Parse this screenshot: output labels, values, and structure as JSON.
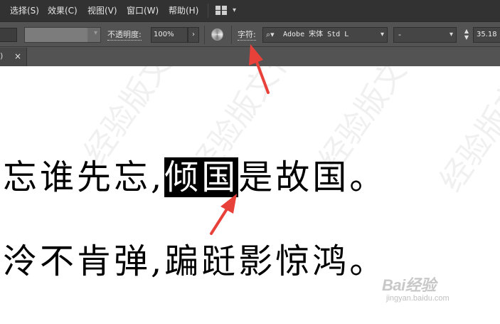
{
  "menubar": {
    "items": [
      "选择(S)",
      "效果(C)",
      "视图(V)",
      "窗口(W)",
      "帮助(H)"
    ]
  },
  "control_bar": {
    "opacity_label": "不透明度:",
    "opacity_value": "100%",
    "character_label": "字符:",
    "font_family": "Adobe 宋体 Std L",
    "font_style": "-",
    "font_size": "35.18"
  },
  "tabs": {
    "partial_label": ")",
    "close_glyph": "×"
  },
  "document": {
    "line1": {
      "before": "忘谁先忘,",
      "selected": "倾国",
      "after": "是故国。"
    },
    "line2": "泠不肯弹,蹁跹影惊鸿。"
  },
  "watermark": {
    "text": "经验版文化经验版",
    "baidu_logo": "Bai经验",
    "baidu_url": "jingyan.baidu.com"
  },
  "colors": {
    "menubar_bg": "#323232",
    "controlbar_bg": "#535353",
    "selection_bg": "#000000",
    "annotation_arrow": "#e8413a"
  },
  "icons": [
    "workspace-grid-icon",
    "chevron-down-icon",
    "recolor-artwork-icon",
    "font-search-icon",
    "close-icon",
    "stepper-arrows-icon",
    "chevron-right-icon"
  ]
}
